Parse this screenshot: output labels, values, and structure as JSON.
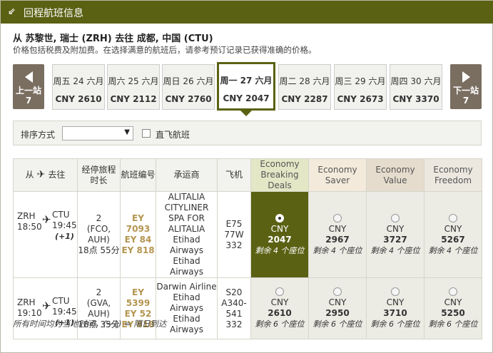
{
  "header": {
    "title": "回程航班信息",
    "arrow": "⇙"
  },
  "route": "从 苏黎世, 瑞士 (ZRH) 去往 成都, 中国 (CTU)",
  "note": "价格包括税费及附加费。在选择满意的航班后，请参考预订记录已获得准确的价格。",
  "nav": {
    "prev_label": "上一站",
    "prev_count": "7",
    "next_label": "下一站",
    "next_count": "7"
  },
  "days": [
    {
      "date": "周五 24 六月",
      "price": "CNY 2610"
    },
    {
      "date": "周六 25 六月",
      "price": "CNY 2112"
    },
    {
      "date": "周日 26 六月",
      "price": "CNY 2760"
    },
    {
      "date": "周一 27 六月",
      "price": "CNY 2047"
    },
    {
      "date": "周二 28 六月",
      "price": "CNY 2287"
    },
    {
      "date": "周三 29 六月",
      "price": "CNY 2673"
    },
    {
      "date": "周四 30 六月",
      "price": "CNY 3370"
    }
  ],
  "sort": {
    "label": "排序方式",
    "selected": "",
    "direct_label": "直飞航班"
  },
  "table": {
    "headers": {
      "from": "从",
      "to": "去往",
      "stops": "经停旅程时长",
      "flight_no": "航班编号",
      "carrier": "承运商",
      "aircraft": "飞机",
      "fares": [
        "Economy Breaking Deals",
        "Economy Saver",
        "Economy Value",
        "Economy Freedom"
      ]
    },
    "rows": [
      {
        "dep_code": "ZRH",
        "dep_time": "18:50",
        "arr_code": "CTU",
        "arr_time": "19:45",
        "next_day": "(+1)",
        "stops": "2",
        "via": "(FCO,",
        "via2": "AUH)",
        "duration": "18点 55分",
        "flights": [
          "EY 7093",
          "EY 84",
          "EY 818"
        ],
        "carrier": "ALITALIA CITYLINER SPA FOR ALITALIA",
        "carrier2": "Etihad Airways",
        "carrier3": "Etihad Airways",
        "aircraft": [
          "E75",
          "77W",
          "332"
        ],
        "fares": [
          {
            "cur": "CNY",
            "amt": "2047",
            "seat": "剩余 4 个座位"
          },
          {
            "cur": "CNY",
            "amt": "2967",
            "seat": "剩余 4 个座位"
          },
          {
            "cur": "CNY",
            "amt": "3727",
            "seat": "剩余 4 个座位"
          },
          {
            "cur": "CNY",
            "amt": "5267",
            "seat": "剩余 4 个座位"
          }
        ]
      },
      {
        "dep_code": "ZRH",
        "dep_time": "19:10",
        "arr_code": "CTU",
        "arr_time": "19:45",
        "next_day": "(+1)",
        "stops": "2",
        "via": "(GVA,",
        "via2": "AUH)",
        "duration": "18点 35分",
        "flights": [
          "EY 5399",
          "EY 52",
          "EY 818"
        ],
        "carrier": "Darwin Airline",
        "carrier2": "Etihad Airways",
        "carrier3": "Etihad Airways",
        "aircraft": [
          "S20",
          "A340-541",
          "332"
        ],
        "fares": [
          {
            "cur": "CNY",
            "amt": "2610",
            "seat": "剩余 6 个座位"
          },
          {
            "cur": "CNY",
            "amt": "2950",
            "seat": "剩余 6 个座位"
          },
          {
            "cur": "CNY",
            "amt": "3710",
            "seat": "剩余 6 个座位"
          },
          {
            "cur": "CNY",
            "amt": "5250",
            "seat": "剩余 6 个座位"
          }
        ]
      }
    ]
  },
  "footnote": "所有时间均为当地时间，(+1) = 隔日到达",
  "colors": {
    "accent": "#5a6113",
    "nav": "#7a6e61",
    "flight_no": "#b3954f"
  }
}
